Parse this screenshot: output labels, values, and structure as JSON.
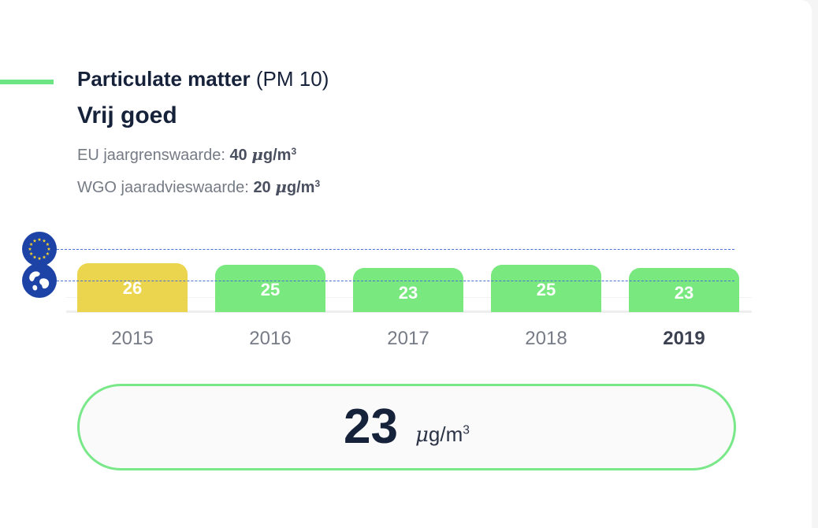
{
  "header": {
    "title_bold": "Particulate matter",
    "title_suffix": "(PM 10)",
    "quality": "Vrij goed"
  },
  "limits": {
    "eu_label": "EU jaargrenswaarde:",
    "eu_value": "40",
    "who_label": "WGO jaaradvieswaarde:",
    "who_value": "20",
    "unit_mu": "μ",
    "unit_rest": "g/m",
    "unit_sup": "3"
  },
  "colors": {
    "accent": "#6ee584",
    "good": "#78e87f",
    "moderate": "#ecd54e",
    "reference_line": "#4870d4",
    "reference_icon": "#1d43a6"
  },
  "icons": {
    "eu": "eu-flag-icon",
    "who": "globe-icon"
  },
  "chart_data": {
    "type": "bar",
    "categories": [
      "2015",
      "2016",
      "2017",
      "2018",
      "2019"
    ],
    "values": [
      26,
      25,
      23,
      25,
      23
    ],
    "value_labels": [
      "26",
      "25",
      "23",
      "25",
      "23"
    ],
    "bar_colors": [
      "#ecd54e",
      "#78e87f",
      "#78e87f",
      "#78e87f",
      "#78e87f"
    ],
    "highlighted_category": "2019",
    "reference_lines": [
      {
        "value": 40,
        "icon": "eu-flag-icon"
      },
      {
        "value": 20,
        "icon": "globe-icon"
      }
    ]
  },
  "current": {
    "value": "23",
    "unit_mu": "μ",
    "unit_rest": "g/m",
    "unit_sup": "3"
  }
}
